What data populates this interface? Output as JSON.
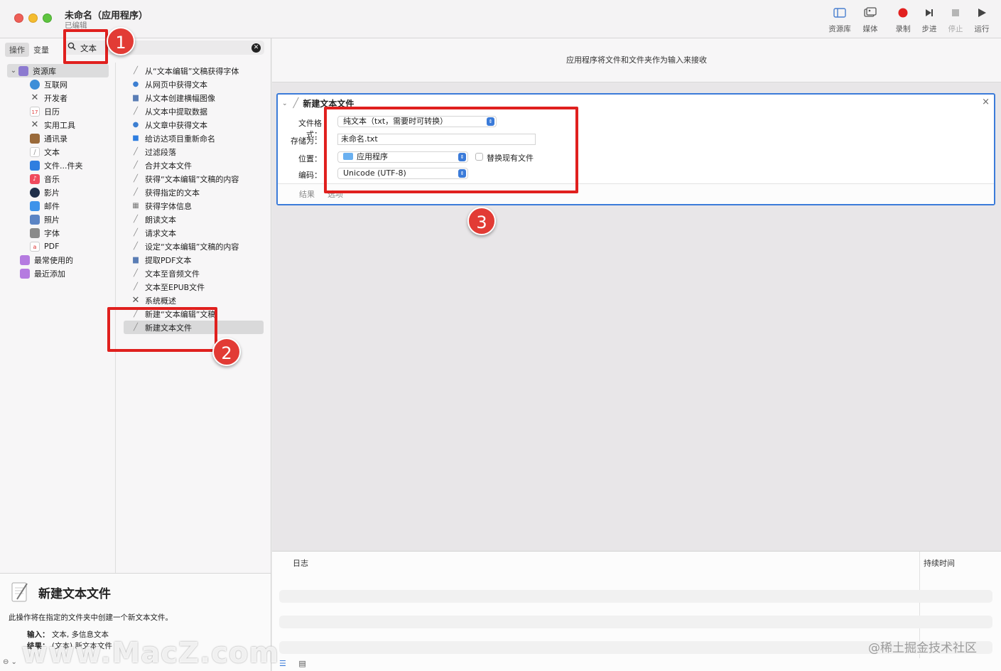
{
  "window": {
    "title": "未命名（应用程序）",
    "subtitle": "已编辑"
  },
  "toolbar": [
    {
      "label": "资源库",
      "icon": "sidebar-icon"
    },
    {
      "label": "媒体",
      "icon": "media-icon"
    },
    {
      "label": "录制",
      "icon": "record-icon"
    },
    {
      "label": "步进",
      "icon": "step-icon"
    },
    {
      "label": "停止",
      "icon": "stop-icon"
    },
    {
      "label": "运行",
      "icon": "run-icon"
    }
  ],
  "left_tabs": {
    "actions": "操作",
    "variables": "变量"
  },
  "search": {
    "value": "文本"
  },
  "library": {
    "root": "资源库",
    "items": [
      "互联网",
      "开发者",
      "日历",
      "实用工具",
      "通讯录",
      "文本",
      "文件...件夹",
      "音乐",
      "影片",
      "邮件",
      "照片",
      "字体",
      "PDF"
    ],
    "smart_groups": [
      "最常使用的",
      "最近添加"
    ]
  },
  "actions": [
    "从“文本编辑”文稿获得字体",
    "从网页中获得文本",
    "从文本创建横幅图像",
    "从文本中提取数据",
    "从文章中获得文本",
    "给访达项目重新命名",
    "过滤段落",
    "合并文本文件",
    "获得“文本编辑”文稿的内容",
    "获得指定的文本",
    "获得字体信息",
    "朗读文本",
    "请求文本",
    "设定“文本编辑”文稿的内容",
    "提取PDF文本",
    "文本至音频文件",
    "文本至EPUB文件",
    "系统概述",
    "新建“文本编辑”文稿",
    "新建文本文件"
  ],
  "description": {
    "name": "新建文本文件",
    "text": "此操作将在指定的文件夹中创建一个新文本文件。",
    "input_label": "输入：",
    "input_value": "文本, 多信息文本",
    "result_label": "结果：",
    "result_value": "(文本) 新文本文件"
  },
  "workflow": {
    "header_message": "应用程序将文件和文件夹作为输入来接收",
    "card_title": "新建文本文件",
    "format_label": "文件格式：",
    "format_value": "纯文本（txt，需要时可转换）",
    "saveas_label": "存储为：",
    "saveas_value": "未命名.txt",
    "location_label": "位置：",
    "location_value": "应用程序",
    "replace_label": "替换现有文件",
    "encoding_label": "编码：",
    "encoding_value": "Unicode (UTF-8)",
    "tab_results": "结果",
    "tab_options": "选项"
  },
  "log": {
    "col_log": "日志",
    "col_duration": "持续时间"
  },
  "annotations": [
    "1",
    "2",
    "3"
  ],
  "watermarks": {
    "left": "www.MacZ.com",
    "right": "@稀土掘金技术社区"
  },
  "colors": {
    "accent": "#3b7bd9",
    "annotation_red": "#e0201e"
  }
}
